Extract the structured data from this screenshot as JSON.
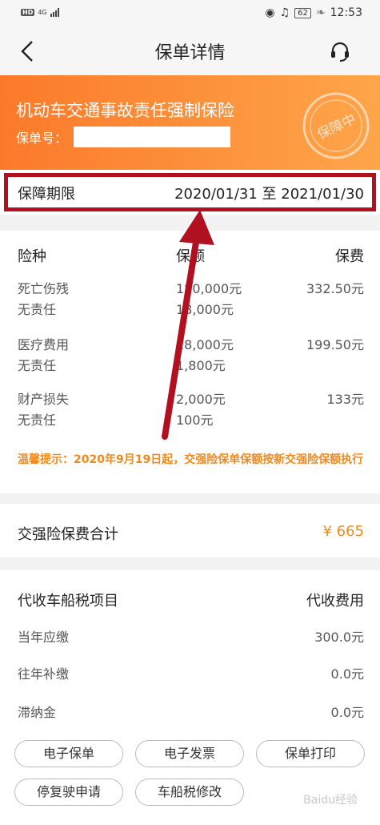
{
  "status_bar": {
    "network_hd": "HD",
    "network_type": "4G",
    "battery": "62",
    "time": "12:53"
  },
  "header": {
    "title": "保单详情",
    "back_icon": "chevron-left-icon",
    "service_icon": "headset-icon"
  },
  "policy": {
    "name": "机动车交通事故责任强制保险",
    "number_label": "保单号：",
    "stamp_text": "保障中"
  },
  "period": {
    "label": "保障期限",
    "value": "2020/01/31 至 2021/01/30"
  },
  "coverage": {
    "headers": [
      "险种",
      "保额",
      "保费"
    ],
    "rows": [
      {
        "type": "死亡伤残",
        "sub": "无责任",
        "amount": "180,000元",
        "sub_amount": "18,000元",
        "premium": "332.50元"
      },
      {
        "type": "医疗费用",
        "sub": "无责任",
        "amount": "18,000元",
        "sub_amount": "1,800元",
        "premium": "199.50元"
      },
      {
        "type": "财产损失",
        "sub": "无责任",
        "amount": "2,000元",
        "sub_amount": "100元",
        "premium": "133元"
      }
    ],
    "tip": "温馨提示：2020年9月19日起，交强险保单保额按新交强险保额执行"
  },
  "total": {
    "label": "交强险保费合计",
    "value": "¥ 665"
  },
  "tax": {
    "header_left": "代收车船税项目",
    "header_right": "代收费用",
    "rows": [
      {
        "label": "当年应缴",
        "value": "300.0元"
      },
      {
        "label": "往年补缴",
        "value": "0.0元"
      },
      {
        "label": "滞纳金",
        "value": "0.0元"
      }
    ]
  },
  "buttons": {
    "e_policy": "电子保单",
    "e_invoice": "电子发票",
    "print_policy": "保单打印",
    "suspend": "停复驶申请",
    "tax_modify": "车船税修改"
  },
  "colors": {
    "brand_orange": "#fb7a2a",
    "accent_orange": "#f08a1e",
    "annotation_red": "#b01020"
  },
  "watermark": "Baidu经验"
}
